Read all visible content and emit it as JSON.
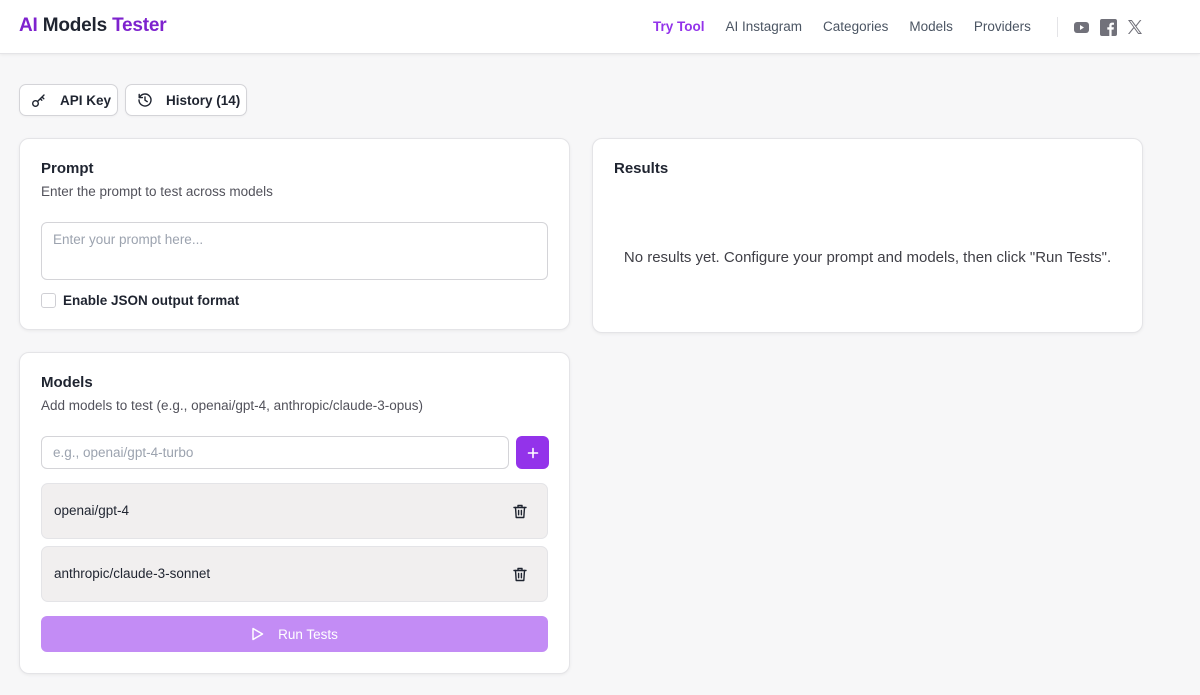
{
  "brand": {
    "part1": "AI",
    "part2": "Models",
    "part3": "Tester"
  },
  "nav": {
    "items": [
      {
        "label": "Try Tool"
      },
      {
        "label": "AI Instagram"
      },
      {
        "label": "Categories"
      },
      {
        "label": "Models"
      },
      {
        "label": "Providers"
      }
    ],
    "active_index": 0,
    "social_icons": [
      "youtube-icon",
      "facebook-icon",
      "x-icon"
    ]
  },
  "toolbar": {
    "api_key_label": "API Key",
    "history_label": "History (14)"
  },
  "prompt": {
    "title": "Prompt",
    "subtitle": "Enter the prompt to test across models",
    "value": "",
    "placeholder": "Enter your prompt here...",
    "json_label": "Enable JSON output format",
    "json_checked": false
  },
  "results": {
    "title": "Results",
    "empty_message": "No results yet. Configure your prompt and models, then click \"Run Tests\"."
  },
  "models": {
    "title": "Models",
    "subtitle": "Add models to test (e.g., openai/gpt-4, anthropic/claude-3-opus)",
    "input_value": "",
    "input_placeholder": "e.g., openai/gpt-4-turbo",
    "list": [
      {
        "name": "openai/gpt-4"
      },
      {
        "name": "anthropic/claude-3-sonnet"
      }
    ],
    "run_label": "Run Tests"
  },
  "colors": {
    "accent": "#9333ea",
    "run_button_disabled": "#c38cf5",
    "model_item_bg": "#f1efef"
  }
}
